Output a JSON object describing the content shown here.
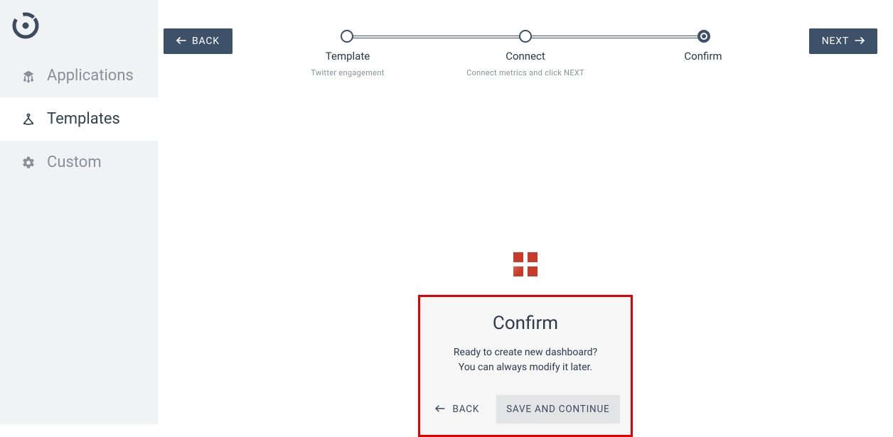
{
  "sidebar": {
    "items": [
      {
        "label": "Applications"
      },
      {
        "label": "Templates"
      },
      {
        "label": "Custom"
      }
    ]
  },
  "topbar": {
    "back_label": "BACK",
    "next_label": "NEXT"
  },
  "stepper": {
    "steps": [
      {
        "label": "Template",
        "sub": "Twitter engagement"
      },
      {
        "label": "Connect",
        "sub": "Connect metrics and click NEXT"
      },
      {
        "label": "Confirm",
        "sub": ""
      }
    ]
  },
  "confirm": {
    "title": "Confirm",
    "line1": "Ready to create new dashboard?",
    "line2": "You can always modify it later.",
    "back_label": "BACK",
    "save_label": "SAVE AND CONTINUE"
  }
}
